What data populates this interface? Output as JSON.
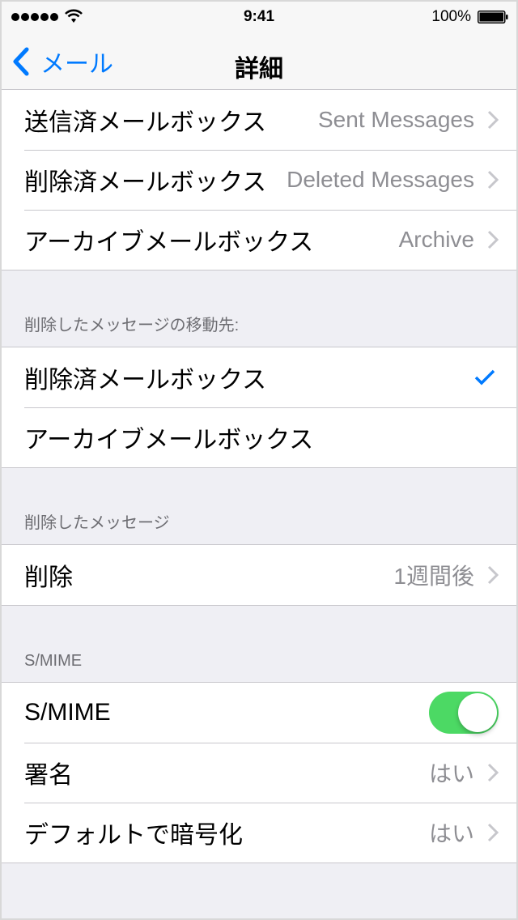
{
  "status_bar": {
    "signal_bars": 5,
    "wifi_icon": "wifi-icon",
    "time": "9:41",
    "battery_percent": "100%",
    "battery_icon": "battery-icon"
  },
  "nav": {
    "back_label": "メール",
    "back_icon": "chevron-left-icon",
    "title": "詳細"
  },
  "mailbox_group": {
    "rows": [
      {
        "label": "送信済メールボックス",
        "value": "Sent Messages"
      },
      {
        "label": "削除済メールボックス",
        "value": "Deleted Messages"
      },
      {
        "label": "アーカイブメールボックス",
        "value": "Archive"
      }
    ]
  },
  "move_deleted": {
    "header": "削除したメッセージの移動先:",
    "options": [
      {
        "label": "削除済メールボックス",
        "selected": true
      },
      {
        "label": "アーカイブメールボックス",
        "selected": false
      }
    ]
  },
  "deleted_messages": {
    "header": "削除したメッセージ",
    "rows": [
      {
        "label": "削除",
        "value": "1週間後"
      }
    ]
  },
  "smime": {
    "header": "S/MIME",
    "toggle_row": {
      "label": "S/MIME",
      "on": true
    },
    "rows": [
      {
        "label": "署名",
        "value": "はい"
      },
      {
        "label": "デフォルトで暗号化",
        "value": "はい"
      }
    ]
  },
  "colors": {
    "accent": "#007aff",
    "toggle_on": "#4cd964",
    "background": "#efeff4",
    "secondary_text": "#8e8e93"
  }
}
